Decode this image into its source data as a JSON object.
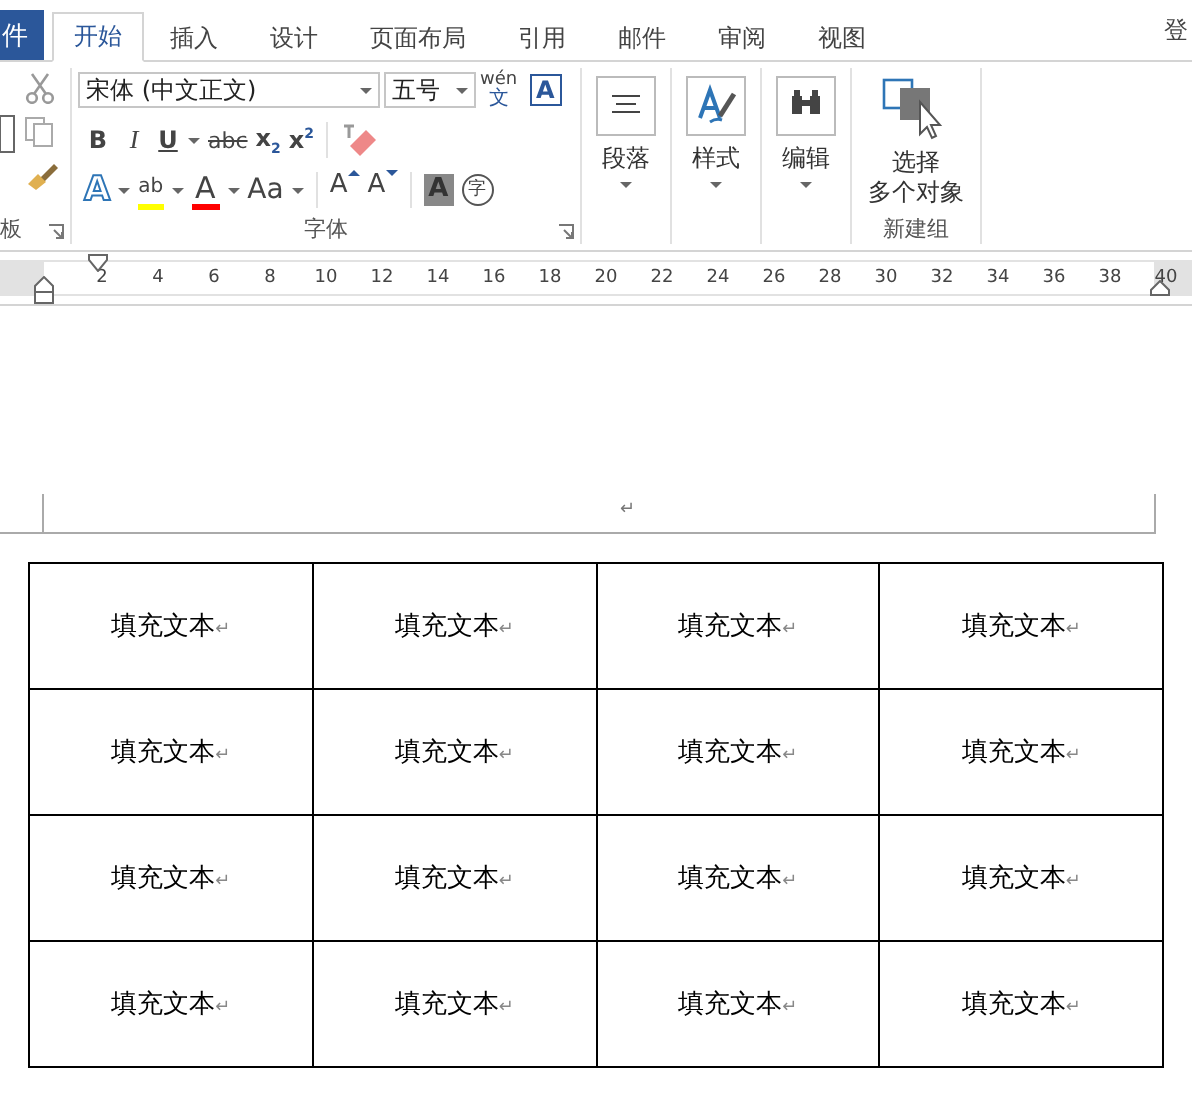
{
  "file_tab": "件",
  "tabs": [
    {
      "label": "开始",
      "selected": true
    },
    {
      "label": "插入",
      "selected": false
    },
    {
      "label": "设计",
      "selected": false
    },
    {
      "label": "页面布局",
      "selected": false
    },
    {
      "label": "引用",
      "selected": false
    },
    {
      "label": "邮件",
      "selected": false
    },
    {
      "label": "审阅",
      "selected": false
    },
    {
      "label": "视图",
      "selected": false
    }
  ],
  "account": "登",
  "clipboard": {
    "label": "板"
  },
  "font": {
    "name": "宋体 (中文正文)",
    "size": "五号",
    "phonetic_top": "wén",
    "phonetic_bottom": "文",
    "border_char": "A",
    "row2": [
      {
        "kind": "bold",
        "text": "B"
      },
      {
        "kind": "italic",
        "text": "I"
      },
      {
        "kind": "underline",
        "text": "U"
      },
      {
        "kind": "strike",
        "text": "abc"
      },
      {
        "kind": "sub",
        "text": "x",
        "script": "2"
      },
      {
        "kind": "sup",
        "text": "x",
        "script": "2"
      }
    ],
    "effects_char": "A",
    "highlight_char": "ab",
    "font_color_char": "A",
    "case_text": "Aa",
    "grow_char": "A",
    "shrink_char": "A",
    "shading_char": "A",
    "enclose_char": "字",
    "label": "字体"
  },
  "big_groups": [
    {
      "kind": "paragraph",
      "label": "段落"
    },
    {
      "kind": "styles",
      "label": "样式"
    },
    {
      "kind": "editing",
      "label": "编辑"
    }
  ],
  "new_group": {
    "line1": "选择",
    "line2": "多个对象",
    "label": "新建组"
  },
  "ruler": [
    "2",
    "4",
    "6",
    "8",
    "10",
    "12",
    "14",
    "16",
    "18",
    "20",
    "22",
    "24",
    "26",
    "28",
    "30",
    "32",
    "34",
    "36",
    "38",
    "40"
  ],
  "page_mark": "↵",
  "table": {
    "rows": [
      [
        {
          "text": "填充文本",
          "mark": "↵"
        },
        {
          "text": "填充文本",
          "mark": "↵"
        },
        {
          "text": "填充文本",
          "mark": "↵"
        },
        {
          "text": "填充文本",
          "mark": "↵"
        }
      ],
      [
        {
          "text": "填充文本",
          "mark": "↵"
        },
        {
          "text": "填充文本",
          "mark": "↵"
        },
        {
          "text": "填充文本",
          "mark": "↵"
        },
        {
          "text": "填充文本",
          "mark": "↵"
        }
      ],
      [
        {
          "text": "填充文本",
          "mark": "↵"
        },
        {
          "text": "填充文本",
          "mark": "↵"
        },
        {
          "text": "填充文本",
          "mark": "↵"
        },
        {
          "text": "填充文本",
          "mark": "↵"
        }
      ],
      [
        {
          "text": "填充文本",
          "mark": "↵"
        },
        {
          "text": "填充文本",
          "mark": "↵"
        },
        {
          "text": "填充文本",
          "mark": "↵"
        },
        {
          "text": "填充文本",
          "mark": "↵"
        }
      ]
    ]
  }
}
